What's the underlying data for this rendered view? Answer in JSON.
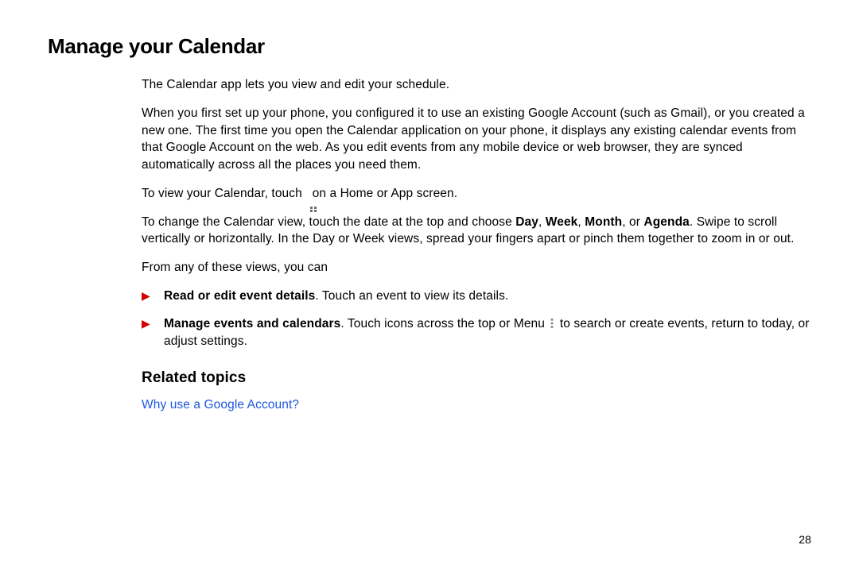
{
  "title": "Manage your Calendar",
  "intro": "The Calendar app lets you view and edit your schedule.",
  "setupPara": "When you first set up your phone, you configured it to use an existing Google Account (such as Gmail), or you created a new one. The first time you open the Calendar application on your phone, it displays any existing calendar events from that Google Account on the web. As you edit events from any mobile device or web browser, they are synced automatically across all the places you need them.",
  "viewCal": {
    "before": "To view your Calendar, touch ",
    "after": " on a Home or App screen."
  },
  "changeView": {
    "prefix": "To change the Calendar view, touch the date at the top and choose ",
    "day": "Day",
    "sep1": ", ",
    "week": "Week",
    "sep2": ", ",
    "month": "Month",
    "sep3": ", or ",
    "agenda": "Agenda",
    "period": ".",
    "swipe": " Swipe to scroll vertically or horizontally. In the Day or Week views, spread your fingers apart or pinch them together to zoom in or out."
  },
  "fromAny": "From any of these views, you can",
  "bullets": [
    {
      "bold": "Read or edit event details",
      "rest": ". Touch an event to view its details."
    },
    {
      "bold": "Manage events and calendars",
      "rest1": ". Touch icons across the top or Menu ",
      "rest2": " to search or create events, return to today, or adjust settings."
    }
  ],
  "relatedHeading": "Related topics",
  "relatedLink": "Why use a Google Account?",
  "pageNumber": "28"
}
